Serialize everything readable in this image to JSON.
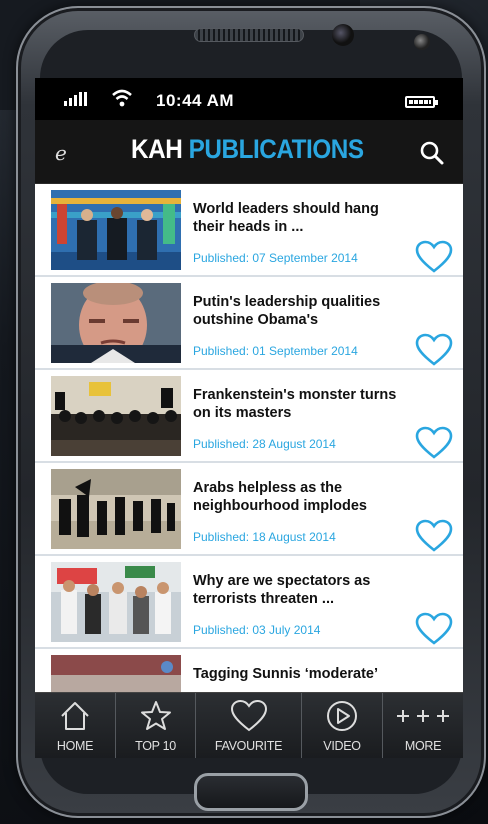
{
  "status_bar": {
    "time": "10:44  AM"
  },
  "app_bar": {
    "logo_char": "e",
    "title_part1": "KAH",
    "title_part2": "PUBLICATIONS"
  },
  "articles": [
    {
      "title": "World leaders should hang their heads in   ...",
      "date": "Published: 07 September 2014"
    },
    {
      "title": "Putin's leadership qualities outshine Obama's",
      "date": "Published: 01 September 2014"
    },
    {
      "title": "Frankenstein's monster turns on its masters",
      "date": "Published: 28 August 2014"
    },
    {
      "title": "Arabs helpless as the neighbourhood implodes",
      "date": "Published: 18 August 2014"
    },
    {
      "title": "Why are we spectators as terrorists threaten  ...",
      "date": "Published: 03 July 2014"
    },
    {
      "title": "Tagging Sunnis ‘moderate’",
      "date": ""
    }
  ],
  "bottom_nav": [
    {
      "label": "HOME",
      "icon": "home-icon"
    },
    {
      "label": "TOP 10",
      "icon": "star-icon"
    },
    {
      "label": "FAVOURITE",
      "icon": "heart-icon"
    },
    {
      "label": "VIDEO",
      "icon": "play-icon"
    },
    {
      "label": "MORE",
      "icon": "plus-icon"
    }
  ],
  "colors": {
    "accent": "#2aa6e0",
    "bar": "#151515",
    "nav": "#2c2f33"
  }
}
